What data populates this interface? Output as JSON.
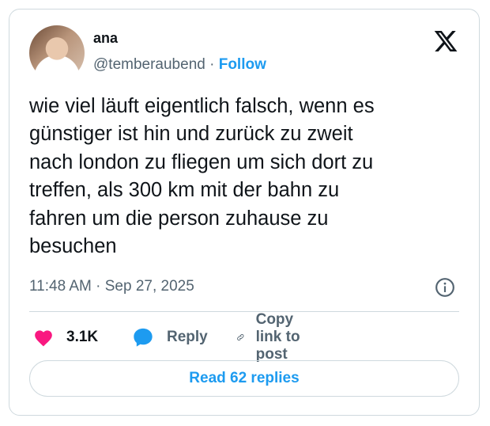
{
  "author": {
    "name": "ana",
    "handle": "@temberaubend",
    "separator": "·",
    "follow_label": "Follow"
  },
  "tweet": {
    "lines": [
      "wie viel läuft eigentlich falsch, wenn es",
      "günstiger ist hin und zurück zu zweit",
      "nach london zu fliegen um sich dort zu",
      "treffen, als 300 km mit der bahn zu",
      "fahren um die person zuhause zu",
      "besuchen"
    ],
    "timestamp": "11:48 AM · Sep 27, 2025"
  },
  "actions": {
    "likes": "3.1K",
    "reply_label": "Reply",
    "copy_label": "Copy link to post"
  },
  "read_replies_label": "Read 62 replies",
  "icons": {
    "logo": "x-logo-icon",
    "info": "info-icon",
    "like": "heart-icon",
    "reply": "speech-bubble-icon",
    "copy": "link-icon"
  },
  "colors": {
    "accent": "#1d9bf0",
    "like": "#f91880",
    "text": "#0f1419",
    "muted": "#536471",
    "border": "#cfd9de"
  }
}
